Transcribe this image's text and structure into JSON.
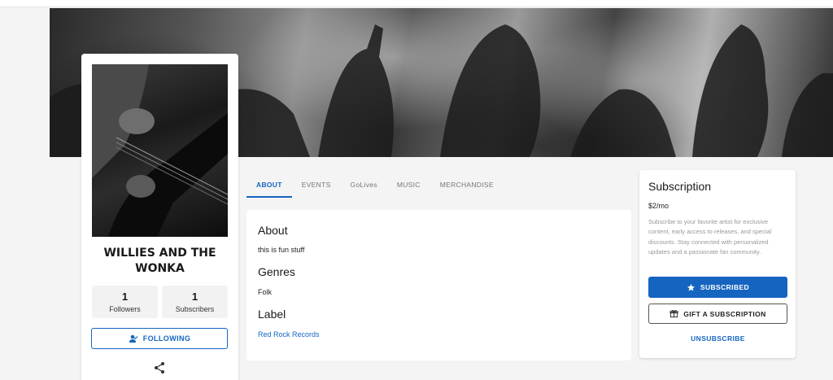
{
  "artist": {
    "name": "WILLIES AND THE WONKA",
    "followers_count": "1",
    "followers_label": "Followers",
    "subscribers_count": "1",
    "subscribers_label": "Subscribers",
    "follow_label": "FOLLOWING"
  },
  "tabs": [
    {
      "label": "ABOUT",
      "active": true
    },
    {
      "label": "EVENTS",
      "active": false
    },
    {
      "label": "GoLives",
      "active": false
    },
    {
      "label": "MUSIC",
      "active": false
    },
    {
      "label": "MERCHANDISE",
      "active": false
    }
  ],
  "about": {
    "about_heading": "About",
    "about_text": "this is fun stuff",
    "genres_heading": "Genres",
    "genres_text": "Folk",
    "label_heading": "Label",
    "label_text": "Red Rock Records"
  },
  "subscription": {
    "title": "Subscription",
    "price": "$2/mo",
    "description": "Subscribe to your favorite artist for exclusive content, early access to releases, and special discounts. Stay connected with personalized updates and a passionate fan community.",
    "subscribed_label": "SUBSCRIBED",
    "gift_label": "GIFT A SUBSCRIPTION",
    "unsubscribe_label": "UNSUBSCRIBE"
  },
  "colors": {
    "accent": "#1565c0",
    "background": "#f4f4f4",
    "card": "#ffffff"
  },
  "icons": {
    "follow": "person-check-icon",
    "share": "share-icon",
    "subscribed": "star-icon",
    "gift": "gift-icon"
  }
}
